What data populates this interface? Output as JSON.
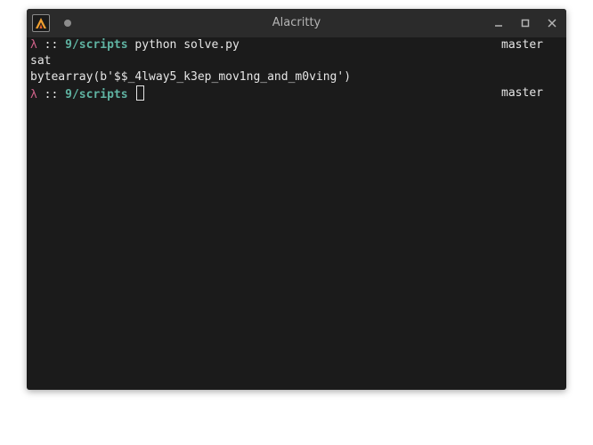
{
  "window": {
    "title": "Alacritty"
  },
  "terminal": {
    "lines": [
      {
        "prompt": {
          "symbol": "λ",
          "separator": " :: ",
          "directory": "9/scripts",
          "command": " python solve.py"
        },
        "branch": "master"
      },
      {
        "text": "sat"
      },
      {
        "text": "bytearray(b'$$_4lway5_k3ep_mov1ng_and_m0ving')"
      },
      {
        "prompt": {
          "symbol": "λ",
          "separator": " :: ",
          "directory": "9/scripts",
          "command": " "
        },
        "branch": "master"
      }
    ]
  },
  "colors": {
    "background": "#1b1b1b",
    "titlebar": "#2b2b2b",
    "lambda": "#d1628a",
    "directory": "#5fb3a2",
    "foreground": "#e6e6e6"
  },
  "icons": {
    "app": "alacritty-logo-icon",
    "minimize": "minimize-icon",
    "maximize": "maximize-icon",
    "close": "close-icon"
  }
}
